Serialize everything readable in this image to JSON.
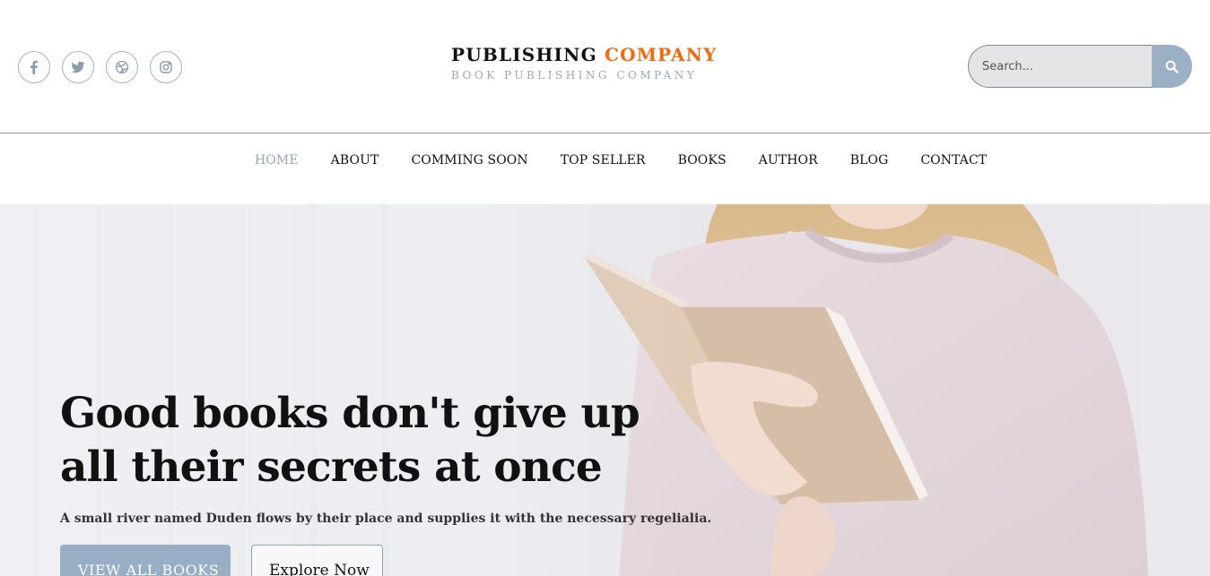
{
  "social": {
    "links": [
      {
        "icon": "facebook-icon"
      },
      {
        "icon": "twitter-icon"
      },
      {
        "icon": "dribbble-icon"
      },
      {
        "icon": "instagram-icon"
      }
    ],
    "icon_color": "#8a9bac"
  },
  "logo": {
    "part1": "PUBLISHING",
    "part2": "COMPANY",
    "tagline": "BOOK PUBLISHING COMPANY",
    "accent_color": "#f26a0f"
  },
  "search": {
    "placeholder": "Search...",
    "icon": "search-icon",
    "button_color": "#9bb0c5"
  },
  "nav": {
    "items": [
      {
        "label": "HOME",
        "active": true
      },
      {
        "label": "ABOUT",
        "active": false
      },
      {
        "label": "COMMING SOON",
        "active": false
      },
      {
        "label": "TOP SELLER",
        "active": false
      },
      {
        "label": "BOOKS",
        "active": false
      },
      {
        "label": "AUTHOR",
        "active": false
      },
      {
        "label": "BLOG",
        "active": false
      },
      {
        "label": "CONTACT",
        "active": false
      }
    ],
    "active_color": "#93a7bc"
  },
  "hero": {
    "title": "Good books don't give up all their secrets at once",
    "subtitle": "A small river named Duden flows by their place and supplies it with the necessary regelialia.",
    "primary_button": "VIEW ALL BOOKS",
    "secondary_button": "Explore Now"
  }
}
